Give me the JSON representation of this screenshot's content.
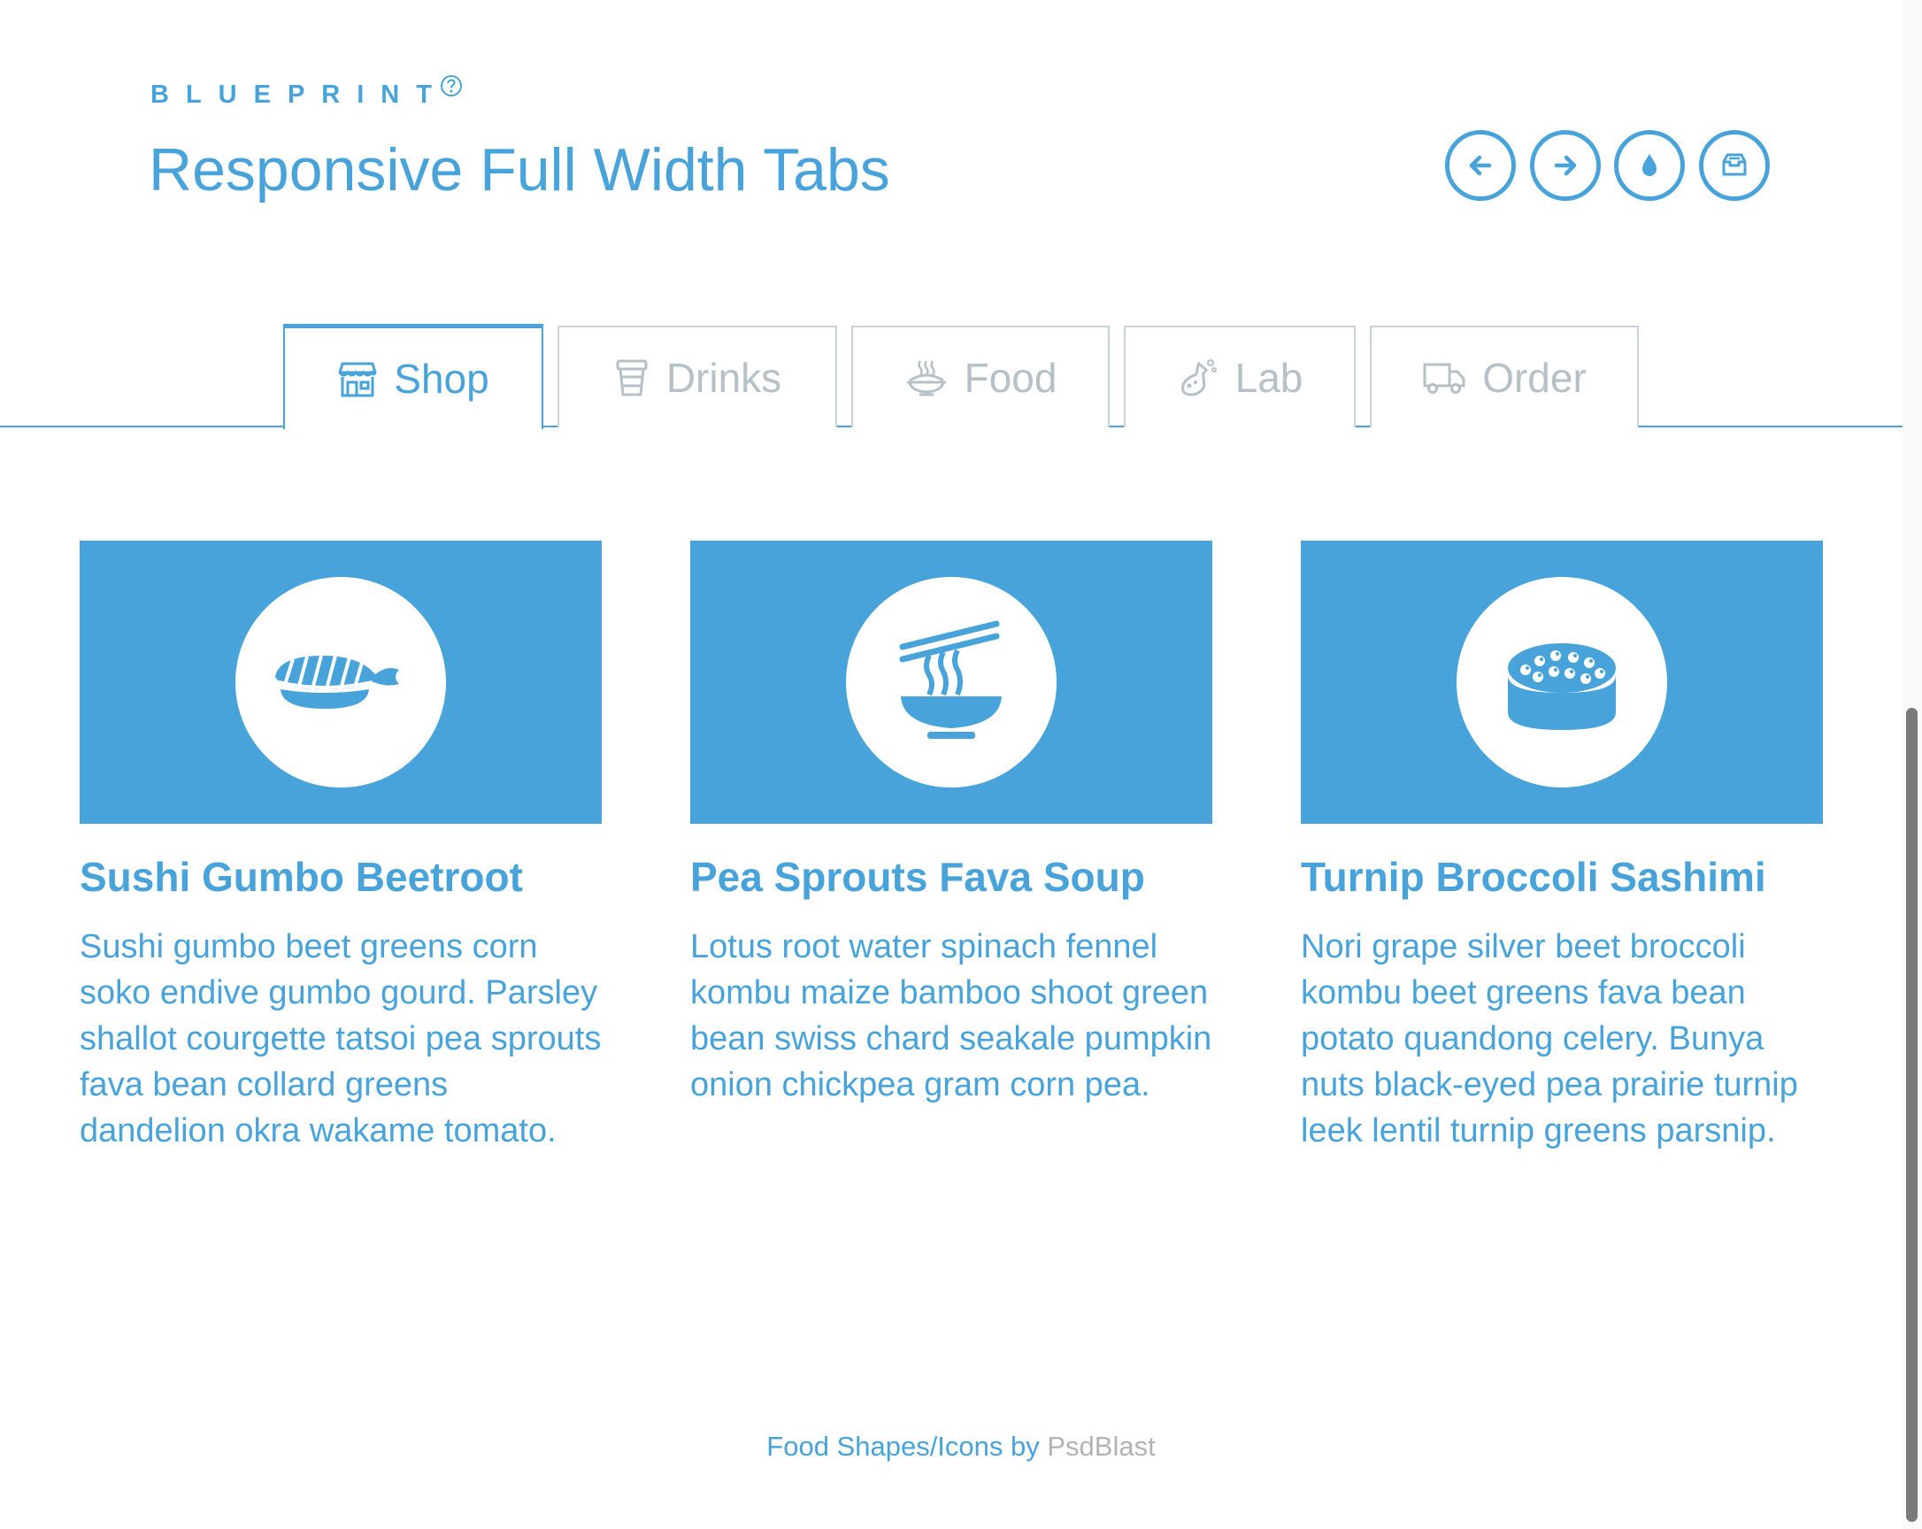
{
  "header": {
    "brand": "BLUEPRINT",
    "title": "Responsive Full Width Tabs",
    "help_icon": "question-circle-icon",
    "nav_buttons": [
      {
        "name": "previous",
        "icon": "arrow-left-icon"
      },
      {
        "name": "next",
        "icon": "arrow-right-icon"
      },
      {
        "name": "drop",
        "icon": "water-drop-icon"
      },
      {
        "name": "archive",
        "icon": "inbox-icon"
      }
    ]
  },
  "tabs": [
    {
      "label": "Shop",
      "icon": "shop-icon",
      "active": true
    },
    {
      "label": "Drinks",
      "icon": "cup-icon",
      "active": false
    },
    {
      "label": "Food",
      "icon": "food-bowl-icon",
      "active": false
    },
    {
      "label": "Lab",
      "icon": "flask-icon",
      "active": false
    },
    {
      "label": "Order",
      "icon": "truck-icon",
      "active": false
    }
  ],
  "cards": [
    {
      "icon": "sushi-shrimp-icon",
      "title": "Sushi Gumbo Beetroot",
      "text": "Sushi gumbo beet greens corn soko endive gumbo gourd. Parsley shallot courgette tatsoi pea sprouts fava bean collard greens dandelion okra wakame tomato."
    },
    {
      "icon": "noodle-bowl-icon",
      "title": "Pea Sprouts Fava Soup",
      "text": "Lotus root water spinach fennel kombu maize bamboo shoot green bean swiss chard seakale pumpkin onion chickpea gram corn pea."
    },
    {
      "icon": "sushi-roe-icon",
      "title": "Turnip Broccoli Sashimi",
      "text": "Nori grape silver beet broccoli kombu beet greens fava bean potato quandong celery. Bunya nuts black-eyed pea prairie turnip leek lentil turnip greens parsnip."
    }
  ],
  "footer": {
    "text": "Food Shapes/Icons by ",
    "link": "PsdBlast"
  },
  "colors": {
    "accent": "#47a3da",
    "inactive_tab": "#b5c0c7",
    "tab_border": "#c7d3dc",
    "footer_link": "#b3b3b3"
  }
}
